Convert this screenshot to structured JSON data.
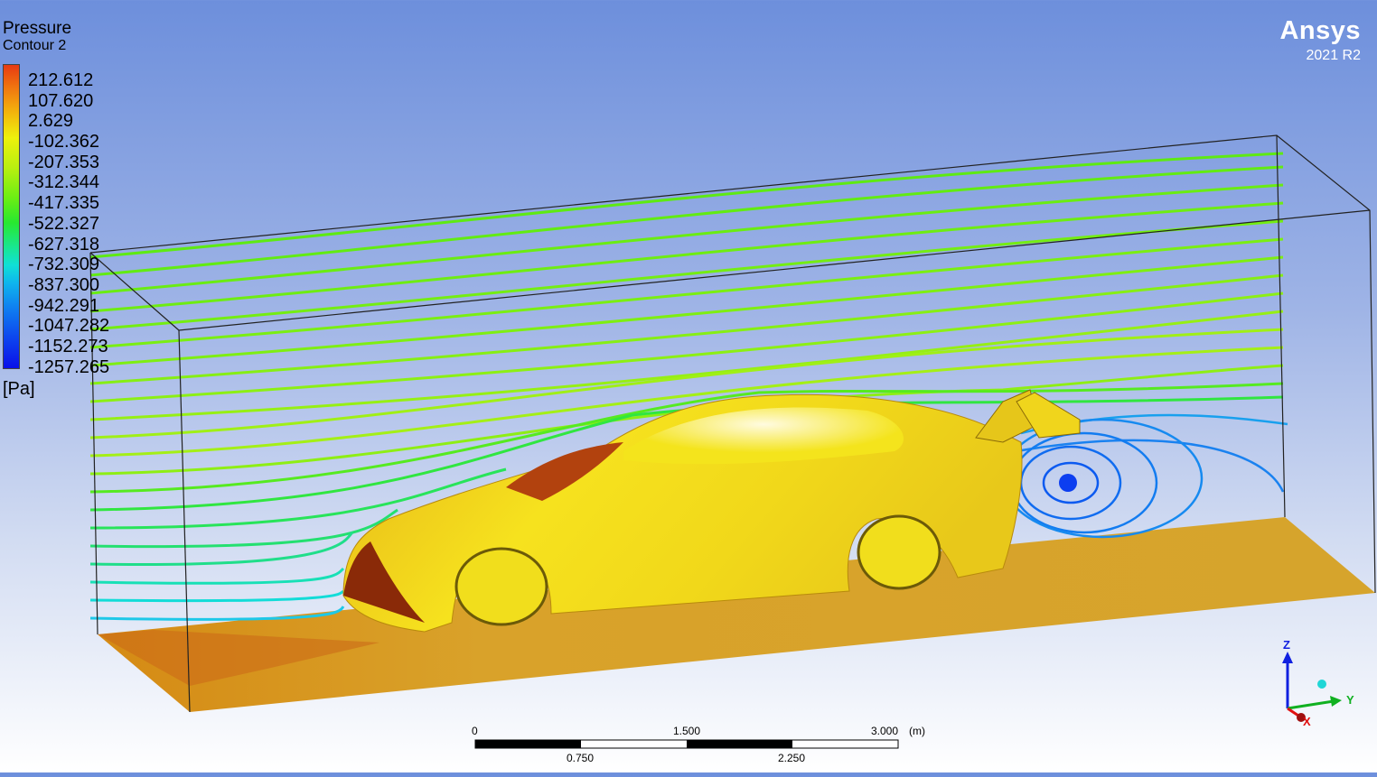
{
  "legend": {
    "title": "Pressure",
    "subtitle": "Contour 2",
    "unit": "[Pa]",
    "ticks": [
      "212.612",
      "107.620",
      "2.629",
      "-102.362",
      "-207.353",
      "-312.344",
      "-417.335",
      "-522.327",
      "-627.318",
      "-732.309",
      "-837.300",
      "-942.291",
      "-1047.282",
      "-1152.273",
      "-1257.265"
    ]
  },
  "brand": {
    "name": "Ansys",
    "version": "2021 R2"
  },
  "scale_bar": {
    "top_labels": [
      "0",
      "1.500",
      "3.000"
    ],
    "unit": "(m)",
    "bottom_labels": [
      "0.750",
      "2.250"
    ]
  },
  "axes": {
    "z": "Z",
    "y": "Y",
    "x": "X"
  },
  "colors": {
    "max": "#e83a12",
    "mid": "#eef10c",
    "low": "#27e830",
    "min": "#0a10ea"
  }
}
